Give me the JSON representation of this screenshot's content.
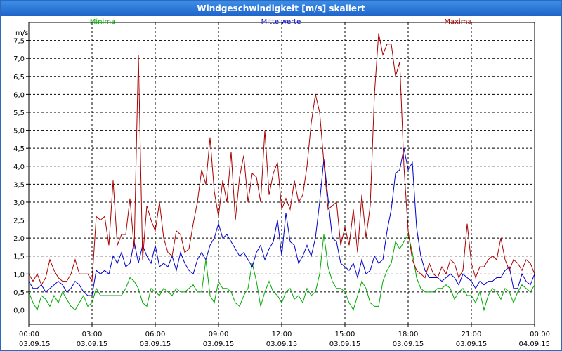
{
  "window": {
    "title": "Windgeschwindigkeit [m/s] skaliert"
  },
  "chart_data": {
    "type": "line",
    "title": "Windgeschwindigkeit [m/s] skaliert",
    "ylabel": "m/s",
    "ylim": [
      -0.4,
      8.0
    ],
    "yticks": [
      "0,0",
      "0,5",
      "1,0",
      "1,5",
      "2,0",
      "2,5",
      "3,0",
      "3,5",
      "4,0",
      "4,5",
      "5,0",
      "5,5",
      "6,0",
      "6,5",
      "7,0",
      "7,5"
    ],
    "xlim_hours": [
      0,
      24
    ],
    "xticks": [
      {
        "time": "00:00",
        "date": "03.09.15"
      },
      {
        "time": "03:00",
        "date": "03.09.15"
      },
      {
        "time": "06:00",
        "date": "03.09.15"
      },
      {
        "time": "09:00",
        "date": "03.09.15"
      },
      {
        "time": "12:00",
        "date": "03.09.15"
      },
      {
        "time": "15:00",
        "date": "03.09.15"
      },
      {
        "time": "18:00",
        "date": "03.09.15"
      },
      {
        "time": "21:00",
        "date": "03.09.15"
      },
      {
        "time": "00:00",
        "date": "04.09.15"
      }
    ],
    "grid": true,
    "legend_position": "top",
    "series": [
      {
        "name": "Minima",
        "color": "#00aa00",
        "x": [
          0,
          0.2,
          0.4,
          0.6,
          0.8,
          1,
          1.2,
          1.4,
          1.6,
          1.8,
          2,
          2.2,
          2.4,
          2.6,
          2.8,
          3,
          3.2,
          3.4,
          3.6,
          3.8,
          4,
          4.2,
          4.4,
          4.6,
          4.8,
          5,
          5.2,
          5.4,
          5.6,
          5.8,
          6,
          6.2,
          6.4,
          6.6,
          6.8,
          7,
          7.2,
          7.4,
          7.6,
          7.8,
          8,
          8.2,
          8.4,
          8.6,
          8.8,
          9,
          9.2,
          9.4,
          9.6,
          9.8,
          10,
          10.2,
          10.4,
          10.6,
          10.8,
          11,
          11.2,
          11.4,
          11.6,
          11.8,
          12,
          12.2,
          12.4,
          12.6,
          12.8,
          13,
          13.2,
          13.4,
          13.6,
          13.8,
          14,
          14.2,
          14.4,
          14.6,
          14.8,
          15,
          15.2,
          15.4,
          15.6,
          15.8,
          16,
          16.2,
          16.4,
          16.6,
          16.8,
          17,
          17.2,
          17.4,
          17.6,
          17.8,
          18,
          18.2,
          18.4,
          18.6,
          18.8,
          19,
          19.2,
          19.4,
          19.6,
          19.8,
          20,
          20.2,
          20.4,
          20.6,
          20.8,
          21,
          21.2,
          21.4,
          21.6,
          21.8,
          22,
          22.2,
          22.4,
          22.6,
          22.8,
          23,
          23.2,
          23.4,
          23.6,
          23.8,
          24
        ],
        "values": [
          0.5,
          0.2,
          0.0,
          0.4,
          0.3,
          0.1,
          0.4,
          0.2,
          0.5,
          0.3,
          0.1,
          0.0,
          0.2,
          0.4,
          0.1,
          0.2,
          0.6,
          0.4,
          0.4,
          0.4,
          0.4,
          0.4,
          0.4,
          0.6,
          0.9,
          0.8,
          0.6,
          0.2,
          0.1,
          0.6,
          0.5,
          0.4,
          0.6,
          0.5,
          0.4,
          0.6,
          0.5,
          0.5,
          0.6,
          0.7,
          0.5,
          0.5,
          1.4,
          0.4,
          0.2,
          0.8,
          0.6,
          0.6,
          0.5,
          0.2,
          0.1,
          0.4,
          0.6,
          1.3,
          0.8,
          0.1,
          0.5,
          0.8,
          0.5,
          0.4,
          0.2,
          0.5,
          0.6,
          0.3,
          0.4,
          0.2,
          0.6,
          0.4,
          0.5,
          1.0,
          2.1,
          1.2,
          0.8,
          0.6,
          0.6,
          0.5,
          0.2,
          0.0,
          0.4,
          0.8,
          0.6,
          0.2,
          0.1,
          0.1,
          0.8,
          1.1,
          1.3,
          1.9,
          1.7,
          1.9,
          2.1,
          1.6,
          0.9,
          0.6,
          0.5,
          0.5,
          0.5,
          0.6,
          0.6,
          0.7,
          0.6,
          0.3,
          0.5,
          0.6,
          0.4,
          0.4,
          0.2,
          0.5,
          0.0,
          0.4,
          0.6,
          0.5,
          0.3,
          0.6,
          0.5,
          0.2,
          0.5,
          0.7,
          0.6,
          0.5,
          0.7
        ]
      },
      {
        "name": "Mittelwerte",
        "color": "#0000cc",
        "x": [
          0,
          0.2,
          0.4,
          0.6,
          0.8,
          1,
          1.2,
          1.4,
          1.6,
          1.8,
          2,
          2.2,
          2.4,
          2.6,
          2.8,
          3,
          3.2,
          3.4,
          3.6,
          3.8,
          4,
          4.2,
          4.4,
          4.6,
          4.8,
          5,
          5.2,
          5.4,
          5.6,
          5.8,
          6,
          6.2,
          6.4,
          6.6,
          6.8,
          7,
          7.2,
          7.4,
          7.6,
          7.8,
          8,
          8.2,
          8.4,
          8.6,
          8.8,
          9,
          9.2,
          9.4,
          9.6,
          9.8,
          10,
          10.2,
          10.4,
          10.6,
          10.8,
          11,
          11.2,
          11.4,
          11.6,
          11.8,
          12,
          12.2,
          12.4,
          12.6,
          12.8,
          13,
          13.2,
          13.4,
          13.6,
          13.8,
          14,
          14.2,
          14.4,
          14.6,
          14.8,
          15,
          15.2,
          15.4,
          15.6,
          15.8,
          16,
          16.2,
          16.4,
          16.6,
          16.8,
          17,
          17.2,
          17.4,
          17.6,
          17.8,
          18,
          18.2,
          18.4,
          18.6,
          18.8,
          19,
          19.2,
          19.4,
          19.6,
          19.8,
          20,
          20.2,
          20.4,
          20.6,
          20.8,
          21,
          21.2,
          21.4,
          21.6,
          21.8,
          22,
          22.2,
          22.4,
          22.6,
          22.8,
          23,
          23.2,
          23.4,
          23.6,
          23.8,
          24
        ],
        "values": [
          0.8,
          0.6,
          0.6,
          0.7,
          0.5,
          0.6,
          0.7,
          0.8,
          0.7,
          0.5,
          0.6,
          0.8,
          0.7,
          0.5,
          0.4,
          0.4,
          1.1,
          1.0,
          1.1,
          1.0,
          1.5,
          1.3,
          1.6,
          1.2,
          1.3,
          1.9,
          1.3,
          1.8,
          1.5,
          1.3,
          1.8,
          1.2,
          1.3,
          1.2,
          1.5,
          1.1,
          1.6,
          1.3,
          1.1,
          1.0,
          1.4,
          1.6,
          1.4,
          1.8,
          2.0,
          2.4,
          2.0,
          2.1,
          1.9,
          1.7,
          1.5,
          1.6,
          1.4,
          1.2,
          1.6,
          1.8,
          1.4,
          1.7,
          1.9,
          2.5,
          1.5,
          2.7,
          1.9,
          1.8,
          1.3,
          1.5,
          1.8,
          1.5,
          2.0,
          3.0,
          4.2,
          3.1,
          2.0,
          1.9,
          1.3,
          1.2,
          1.1,
          1.3,
          0.9,
          1.4,
          1.0,
          1.1,
          1.5,
          1.3,
          1.4,
          2.2,
          2.8,
          3.8,
          3.9,
          4.5,
          3.9,
          4.1,
          2.3,
          1.5,
          1.1,
          0.9,
          0.9,
          0.9,
          0.8,
          0.9,
          1.0,
          0.9,
          0.7,
          1.0,
          0.9,
          0.8,
          0.6,
          0.8,
          0.7,
          0.8,
          0.8,
          0.9,
          0.9,
          1.1,
          1.2,
          0.6,
          0.6,
          1.0,
          0.8,
          0.7,
          1.0
        ]
      },
      {
        "name": "Maxima",
        "color": "#aa0000",
        "x": [
          0,
          0.2,
          0.4,
          0.6,
          0.8,
          1,
          1.2,
          1.4,
          1.6,
          1.8,
          2,
          2.2,
          2.4,
          2.6,
          2.8,
          3,
          3.2,
          3.4,
          3.6,
          3.8,
          4,
          4.2,
          4.4,
          4.6,
          4.8,
          5,
          5.2,
          5.4,
          5.6,
          5.8,
          6,
          6.2,
          6.4,
          6.6,
          6.8,
          7,
          7.2,
          7.4,
          7.6,
          7.8,
          8,
          8.2,
          8.4,
          8.6,
          8.8,
          9,
          9.2,
          9.4,
          9.6,
          9.8,
          10,
          10.2,
          10.4,
          10.6,
          10.8,
          11,
          11.2,
          11.4,
          11.6,
          11.8,
          12,
          12.2,
          12.4,
          12.6,
          12.8,
          13,
          13.2,
          13.4,
          13.6,
          13.8,
          14,
          14.2,
          14.4,
          14.6,
          14.8,
          15,
          15.2,
          15.4,
          15.6,
          15.8,
          16,
          16.2,
          16.4,
          16.6,
          16.8,
          17,
          17.2,
          17.4,
          17.6,
          17.8,
          18,
          18.2,
          18.4,
          18.6,
          18.8,
          19,
          19.2,
          19.4,
          19.6,
          19.8,
          20,
          20.2,
          20.4,
          20.6,
          20.8,
          21,
          21.2,
          21.4,
          21.6,
          21.8,
          22,
          22.2,
          22.4,
          22.6,
          22.8,
          23,
          23.2,
          23.4,
          23.6,
          23.8,
          24
        ],
        "values": [
          1.0,
          0.8,
          1.0,
          0.7,
          0.9,
          1.4,
          1.1,
          0.9,
          0.8,
          0.8,
          1.0,
          1.4,
          1.0,
          1.0,
          1.0,
          0.8,
          2.6,
          2.5,
          2.6,
          1.8,
          3.6,
          1.8,
          2.1,
          2.1,
          3.1,
          1.7,
          7.1,
          1.4,
          2.9,
          2.5,
          2.2,
          3.0,
          2.0,
          1.6,
          1.5,
          2.2,
          2.1,
          1.6,
          1.7,
          2.4,
          3.0,
          3.9,
          3.5,
          4.8,
          3.3,
          2.6,
          3.6,
          3.0,
          4.4,
          2.5,
          3.7,
          4.3,
          3.0,
          3.8,
          3.7,
          3.0,
          5.0,
          3.2,
          3.8,
          4.1,
          2.8,
          3.1,
          2.8,
          3.6,
          3.0,
          3.2,
          4.0,
          5.2,
          6.0,
          5.5,
          4.1,
          2.8,
          2.9,
          3.0,
          1.8,
          2.3,
          1.8,
          2.8,
          1.6,
          3.2,
          2.0,
          2.9,
          6.0,
          7.7,
          7.1,
          7.4,
          7.4,
          6.5,
          6.9,
          4.0,
          2.2,
          1.4,
          1.1,
          1.0,
          0.9,
          1.3,
          1.0,
          0.9,
          1.2,
          1.0,
          1.4,
          1.3,
          0.9,
          1.1,
          2.4,
          1.3,
          0.9,
          1.2,
          1.2,
          1.4,
          1.5,
          1.4,
          2.0,
          1.4,
          1.1,
          1.4,
          1.3,
          1.1,
          1.4,
          1.3,
          1.0
        ]
      }
    ]
  }
}
